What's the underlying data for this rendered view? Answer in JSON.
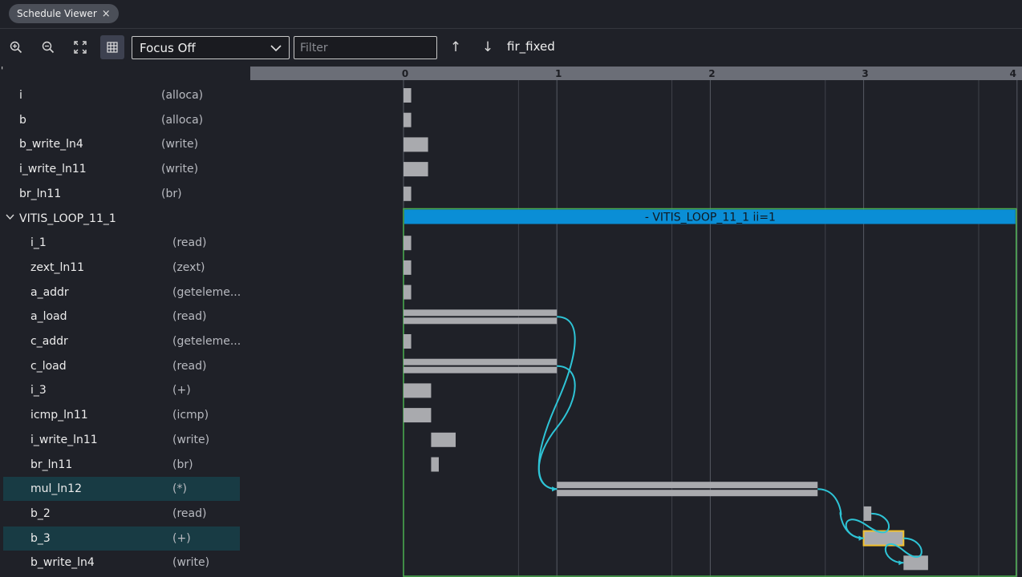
{
  "tab": {
    "label": "Schedule Viewer",
    "close": "×"
  },
  "toolbar": {
    "icons": [
      "zoom-in-icon",
      "zoom-out-icon",
      "fit-screen-icon",
      "table-view-icon"
    ],
    "focus": "Focus Off",
    "filter_placeholder": "Filter",
    "filter_value": "",
    "up": "↑",
    "down": "↓",
    "function_name": "fir_fixed"
  },
  "left_ruler_mark": "'",
  "rows": [
    {
      "name": "i",
      "type": "(alloca)",
      "indent": 0
    },
    {
      "name": "b",
      "type": "(alloca)",
      "indent": 0
    },
    {
      "name": "b_write_ln4",
      "type": "(write)",
      "indent": 0
    },
    {
      "name": "i_write_ln11",
      "type": "(write)",
      "indent": 0
    },
    {
      "name": "br_ln11",
      "type": "(br)",
      "indent": 0
    },
    {
      "name": "VITIS_LOOP_11_1",
      "type": "",
      "indent": 0,
      "group": true
    },
    {
      "name": "i_1",
      "type": "(read)",
      "indent": 1
    },
    {
      "name": "zext_ln11",
      "type": "(zext)",
      "indent": 1
    },
    {
      "name": "a_addr",
      "type": "(geteleme...",
      "indent": 1
    },
    {
      "name": "a_load",
      "type": "(read)",
      "indent": 1
    },
    {
      "name": "c_addr",
      "type": "(geteleme...",
      "indent": 1
    },
    {
      "name": "c_load",
      "type": "(read)",
      "indent": 1
    },
    {
      "name": "i_3",
      "type": "(+)",
      "indent": 1
    },
    {
      "name": "icmp_ln11",
      "type": "(icmp)",
      "indent": 1
    },
    {
      "name": "i_write_ln11",
      "type": "(write)",
      "indent": 1
    },
    {
      "name": "br_ln11",
      "type": "(br)",
      "indent": 1
    },
    {
      "name": "mul_ln12",
      "type": "(*)",
      "indent": 1,
      "selected": true
    },
    {
      "name": "b_2",
      "type": "(read)",
      "indent": 1
    },
    {
      "name": "b_3",
      "type": "(+)",
      "indent": 1,
      "selected": true
    },
    {
      "name": "b_write_ln4",
      "type": "(write)",
      "indent": 1
    }
  ],
  "timeline": {
    "ticks": [
      "0",
      "1",
      "2",
      "3",
      "4"
    ],
    "loop_label": "- VITIS_LOOP_11_1   ii=1",
    "colors": {
      "bar": "#a9aaae",
      "loop": "#0a8ed6",
      "loop_border": "#4caf50",
      "arrow": "#2ec4d6",
      "highlight": "#f2c12e"
    },
    "ops": [
      {
        "start": 0,
        "end": 0.05
      },
      {
        "start": 0,
        "end": 0.05
      },
      {
        "start": 0,
        "end": 0.16
      },
      {
        "start": 0,
        "end": 0.16
      },
      {
        "start": 0,
        "end": 0.05
      },
      null,
      {
        "start": 0,
        "end": 0.05
      },
      {
        "start": 0,
        "end": 0.05
      },
      {
        "start": 0,
        "end": 0.05
      },
      {
        "start": 0,
        "end": 1.0,
        "double": true
      },
      {
        "start": 0,
        "end": 0.05
      },
      {
        "start": 0,
        "end": 1.0,
        "double": true
      },
      {
        "start": 0,
        "end": 0.18
      },
      {
        "start": 0,
        "end": 0.18
      },
      {
        "start": 0.18,
        "end": 0.34
      },
      {
        "start": 0.18,
        "end": 0.23
      },
      {
        "start": 1.0,
        "end": 2.7,
        "double": true
      },
      {
        "start": 3.0,
        "end": 3.05
      },
      {
        "start": 3.0,
        "end": 3.26,
        "highlight": true
      },
      {
        "start": 3.26,
        "end": 3.42
      }
    ],
    "deps": [
      {
        "from": 9,
        "to": 16
      },
      {
        "from": 11,
        "to": 16
      },
      {
        "from": 16,
        "to": 18
      },
      {
        "from": 17,
        "to": 18
      },
      {
        "from": 18,
        "to": 19
      }
    ]
  }
}
